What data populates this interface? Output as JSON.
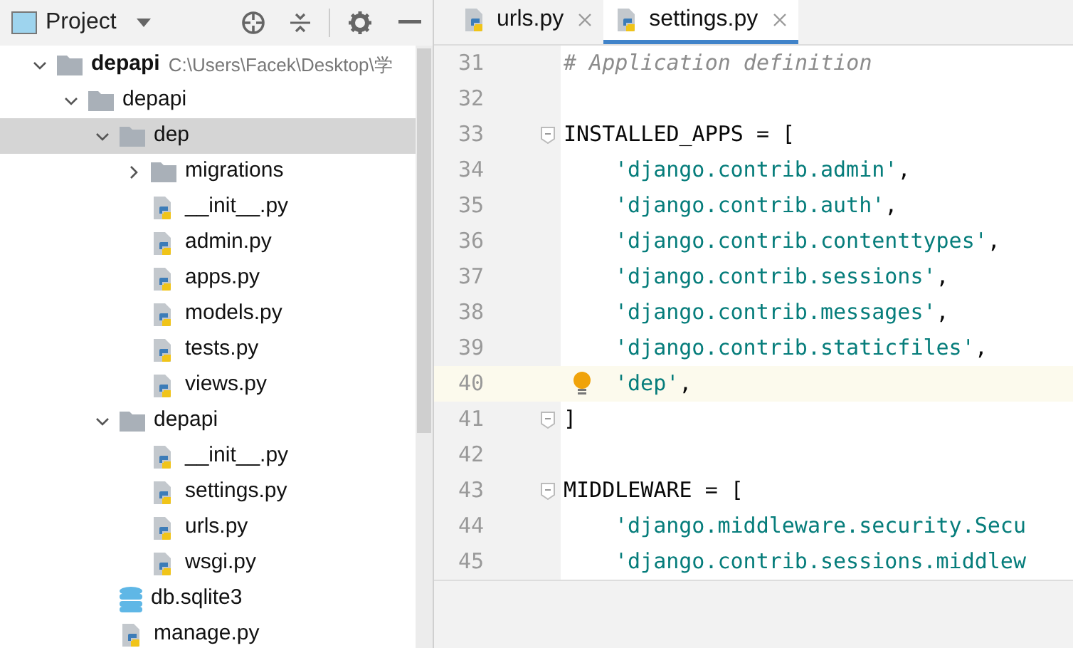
{
  "project_panel": {
    "title": "Project"
  },
  "tree": [
    {
      "kind": "folder",
      "name": "depapi",
      "path": "C:\\Users\\Facek\\Desktop\\学",
      "expanded": true,
      "selected": false,
      "children": [
        {
          "kind": "folder",
          "name": "depapi",
          "expanded": true,
          "selected": false,
          "children": [
            {
              "kind": "folder",
              "name": "dep",
              "expanded": true,
              "selected": true,
              "children": [
                {
                  "kind": "folder",
                  "name": "migrations",
                  "expanded": false,
                  "selected": false
                },
                {
                  "kind": "python",
                  "name": "__init__.py",
                  "selected": false
                },
                {
                  "kind": "python",
                  "name": "admin.py",
                  "selected": false
                },
                {
                  "kind": "python",
                  "name": "apps.py",
                  "selected": false
                },
                {
                  "kind": "python",
                  "name": "models.py",
                  "selected": false
                },
                {
                  "kind": "python",
                  "name": "tests.py",
                  "selected": false
                },
                {
                  "kind": "python",
                  "name": "views.py",
                  "selected": false
                }
              ]
            },
            {
              "kind": "folder",
              "name": "depapi",
              "expanded": true,
              "selected": false,
              "children": [
                {
                  "kind": "python",
                  "name": "__init__.py",
                  "selected": false
                },
                {
                  "kind": "python",
                  "name": "settings.py",
                  "selected": false
                },
                {
                  "kind": "python",
                  "name": "urls.py",
                  "selected": false
                },
                {
                  "kind": "python",
                  "name": "wsgi.py",
                  "selected": false
                }
              ]
            },
            {
              "kind": "database",
              "name": "db.sqlite3",
              "selected": false
            },
            {
              "kind": "python",
              "name": "manage.py",
              "selected": false
            }
          ]
        }
      ]
    }
  ],
  "tabs": [
    {
      "label": "urls.py",
      "selected": false
    },
    {
      "label": "settings.py",
      "selected": true
    }
  ],
  "code": [
    {
      "number": "31",
      "current": false,
      "fold": false,
      "indent": false,
      "segments": [
        {
          "kind": "comment",
          "text": "# Application definition"
        }
      ]
    },
    {
      "number": "32",
      "current": false,
      "fold": false
    },
    {
      "number": "33",
      "current": false,
      "fold": true,
      "indent": false,
      "segments": [
        {
          "kind": "plain",
          "text": "INSTALLED_APPS = ["
        }
      ]
    },
    {
      "number": "34",
      "current": false,
      "fold": false,
      "indent": true,
      "segments": [
        {
          "kind": "string",
          "text": "'django.contrib.admin'"
        },
        {
          "kind": "plain",
          "text": ","
        }
      ]
    },
    {
      "number": "35",
      "current": false,
      "fold": false,
      "indent": true,
      "segments": [
        {
          "kind": "string",
          "text": "'django.contrib.auth'"
        },
        {
          "kind": "plain",
          "text": ","
        }
      ]
    },
    {
      "number": "36",
      "current": false,
      "fold": false,
      "indent": true,
      "segments": [
        {
          "kind": "string",
          "text": "'django.contrib.contenttypes'"
        },
        {
          "kind": "plain",
          "text": ","
        }
      ]
    },
    {
      "number": "37",
      "current": false,
      "fold": false,
      "indent": true,
      "segments": [
        {
          "kind": "string",
          "text": "'django.contrib.sessions'"
        },
        {
          "kind": "plain",
          "text": ","
        }
      ]
    },
    {
      "number": "38",
      "current": false,
      "fold": false,
      "indent": true,
      "segments": [
        {
          "kind": "string",
          "text": "'django.contrib.messages'"
        },
        {
          "kind": "plain",
          "text": ","
        }
      ]
    },
    {
      "number": "39",
      "current": false,
      "fold": false,
      "indent": true,
      "segments": [
        {
          "kind": "string",
          "text": "'django.contrib.staticfiles'"
        },
        {
          "kind": "plain",
          "text": ","
        }
      ]
    },
    {
      "number": "40",
      "current": true,
      "fold": false,
      "indent": true,
      "segments": [
        {
          "kind": "string",
          "text": "'dep'"
        },
        {
          "kind": "plain",
          "text": ","
        }
      ]
    },
    {
      "number": "41",
      "current": false,
      "fold": true,
      "indent": false,
      "segments": [
        {
          "kind": "plain",
          "text": "]"
        }
      ]
    },
    {
      "number": "42",
      "current": false,
      "fold": false
    },
    {
      "number": "43",
      "current": false,
      "fold": true,
      "indent": false,
      "segments": [
        {
          "kind": "plain",
          "text": "MIDDLEWARE = ["
        }
      ]
    },
    {
      "number": "44",
      "current": false,
      "fold": false,
      "indent": true,
      "segments": [
        {
          "kind": "string",
          "text": "'django.middleware.security.Secu"
        }
      ]
    },
    {
      "number": "45",
      "current": false,
      "fold": false,
      "indent": true,
      "segments": [
        {
          "kind": "string",
          "text": "'django.contrib.sessions.middlew"
        }
      ]
    }
  ]
}
